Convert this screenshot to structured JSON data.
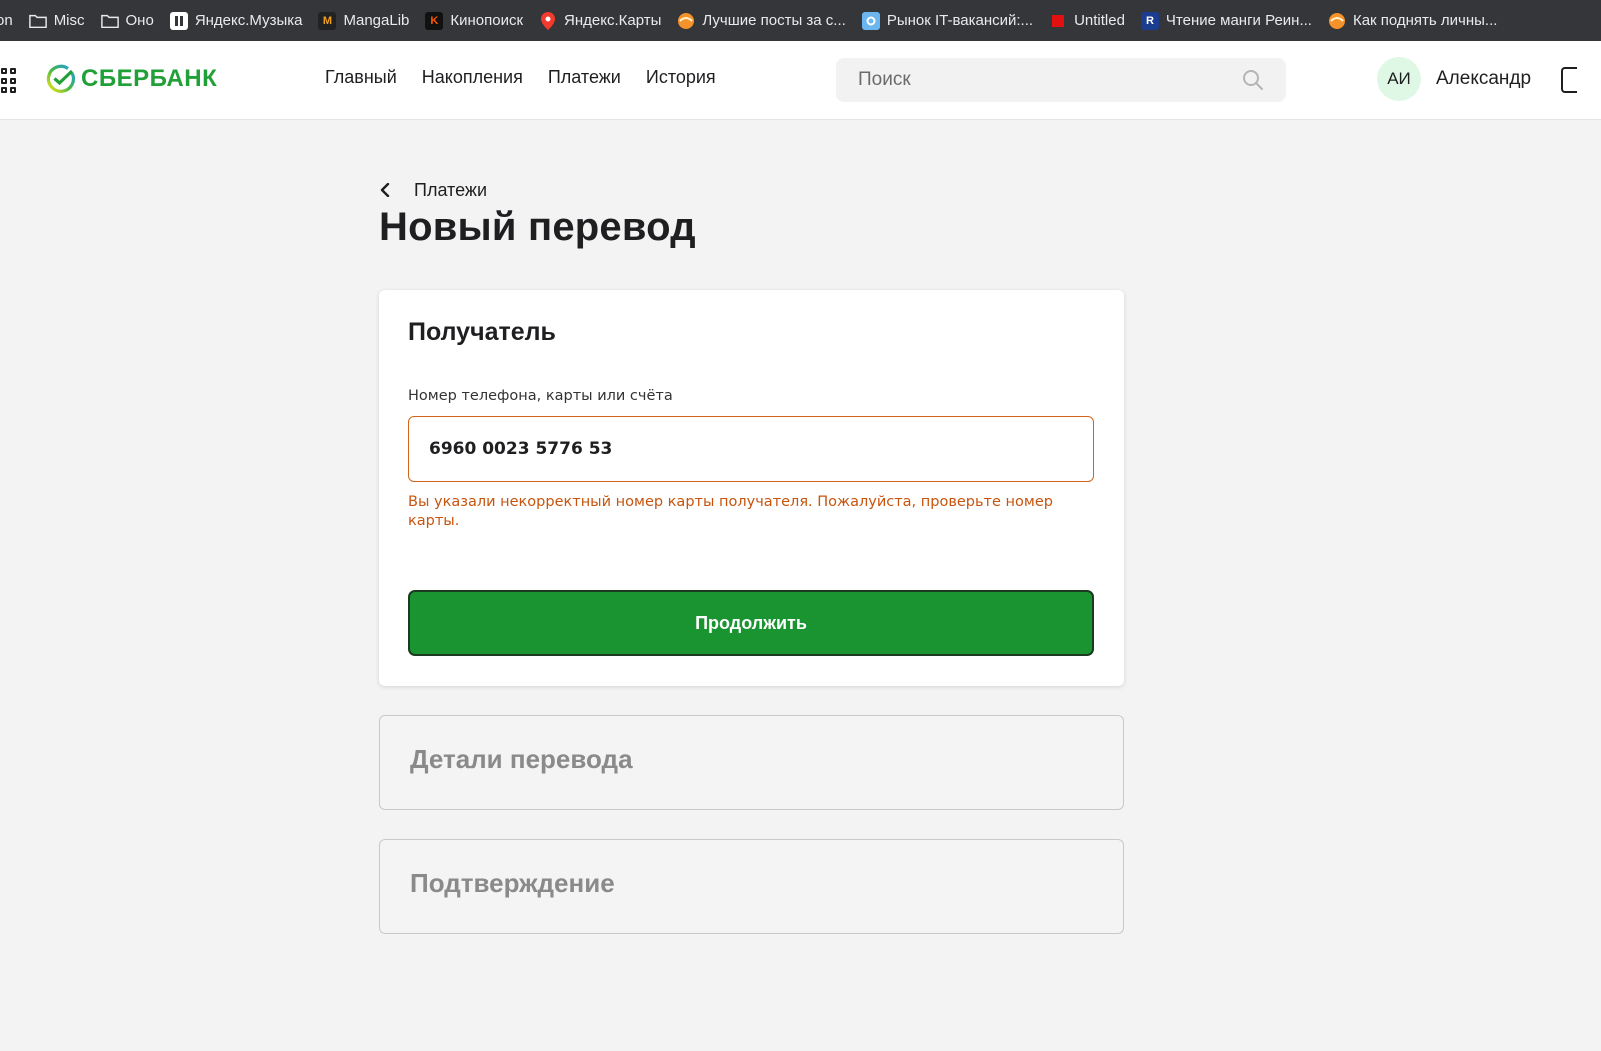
{
  "bookmarks": [
    {
      "label": "on",
      "icon": "blank-icon",
      "color": "#35363a"
    },
    {
      "label": "Misc",
      "icon": "folder-icon",
      "color": "#e8eaed"
    },
    {
      "label": "Оно",
      "icon": "folder-icon",
      "color": "#e8eaed"
    },
    {
      "label": "Яндекс.Музыка",
      "icon": "yandex-music-icon",
      "color": "#ffffff"
    },
    {
      "label": "MangaLib",
      "icon": "mangalib-icon",
      "color": "#f0a020"
    },
    {
      "label": "Кинопоиск",
      "icon": "kinopoisk-icon",
      "color": "#ff5500"
    },
    {
      "label": "Яндекс.Карты",
      "icon": "map-pin-icon",
      "color": "#f33a2e"
    },
    {
      "label": "Лучшие посты за с...",
      "icon": "pikabu-icon",
      "color": "#f5922a"
    },
    {
      "label": "Рынок IT-вакансий:...",
      "icon": "gear-site-icon",
      "color": "#6cb6f0"
    },
    {
      "label": "Untitled",
      "icon": "red-square-icon",
      "color": "#e31010"
    },
    {
      "label": "Чтение манги Реин...",
      "icon": "readmanga-icon",
      "color": "#1b3d8f"
    },
    {
      "label": "Как поднять личны...",
      "icon": "pikabu-icon",
      "color": "#f5922a"
    }
  ],
  "header": {
    "logo_text": "СБЕРБАНК",
    "brand_color": "#21a038",
    "nav": [
      "Главный",
      "Накопления",
      "Платежи",
      "История"
    ],
    "search_placeholder": "Поиск",
    "avatar_initials": "АИ",
    "user_name": "Александр"
  },
  "page": {
    "breadcrumb": "Платежи",
    "title": "Новый перевод"
  },
  "recipient": {
    "title": "Получатель",
    "field_label": "Номер телефона, карты или счёта",
    "field_value": "6960 0023 5776 53",
    "error": "Вы указали некорректный номер карты получателя. Пожалуйста, проверьте номер карты.",
    "error_color": "#c8540e",
    "continue_label": "Продолжить",
    "button_color": "#1a9431"
  },
  "steps": [
    {
      "title": "Детали перевода"
    },
    {
      "title": "Подтверждение"
    }
  ]
}
